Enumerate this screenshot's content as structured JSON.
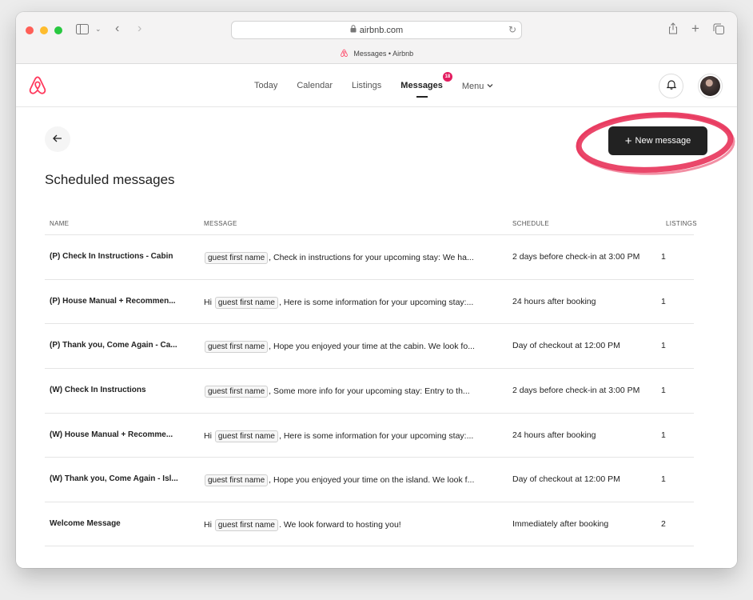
{
  "browser": {
    "url": "airbnb.com",
    "tab_title": "Messages • Airbnb"
  },
  "nav": {
    "links": [
      "Today",
      "Calendar",
      "Listings",
      "Messages",
      "Menu"
    ],
    "active": "Messages",
    "messages_badge": "18"
  },
  "page": {
    "title": "Scheduled messages",
    "new_message_label": "New message"
  },
  "table": {
    "headers": [
      "NAME",
      "MESSAGE",
      "SCHEDULE",
      "LISTINGS"
    ],
    "rows": [
      {
        "name": "(P) Check In Instructions - Cabin",
        "pre": "",
        "tag": "guest first name",
        "text": ", Check in instructions for your upcoming stay: We ha...",
        "schedule": "2 days before check-in at 3:00 PM",
        "listings": "1"
      },
      {
        "name": "(P) House Manual + Recommen...",
        "pre": "Hi",
        "tag": "guest first name",
        "text": ", Here is some information for your upcoming stay:...",
        "schedule": "24 hours after booking",
        "listings": "1"
      },
      {
        "name": "(P) Thank you, Come Again - Ca...",
        "pre": "",
        "tag": "guest first name",
        "text": ", Hope you enjoyed your time at the cabin. We look fo...",
        "schedule": "Day of checkout at 12:00 PM",
        "listings": "1"
      },
      {
        "name": "(W) Check In Instructions",
        "pre": "",
        "tag": "guest first name",
        "text": ", Some more info for your upcoming stay: Entry to th...",
        "schedule": "2 days before check-in at 3:00 PM",
        "listings": "1"
      },
      {
        "name": "(W) House Manual + Recomme...",
        "pre": "Hi",
        "tag": "guest first name",
        "text": ", Here is some information for your upcoming stay:...",
        "schedule": "24 hours after booking",
        "listings": "1"
      },
      {
        "name": "(W) Thank you, Come Again - Isl...",
        "pre": "",
        "tag": "guest first name",
        "text": ", Hope you enjoyed your time on the island. We look f...",
        "schedule": "Day of checkout at 12:00 PM",
        "listings": "1"
      },
      {
        "name": "Welcome Message",
        "pre": "Hi",
        "tag": "guest first name",
        "text": ". We look forward to hosting you!",
        "schedule": "Immediately after booking",
        "listings": "2"
      }
    ]
  },
  "colors": {
    "brand": "#FF385C",
    "badge": "#E31C5F",
    "annotation": "#E8335A",
    "button_bg": "#222222"
  },
  "icons": [
    "airbnb-logo",
    "bell-icon",
    "back-arrow-icon",
    "plus-icon",
    "lock-icon",
    "reload-icon",
    "sidebar-icon",
    "share-icon",
    "new-tab-icon",
    "tabs-icon",
    "chevron-down-icon"
  ]
}
